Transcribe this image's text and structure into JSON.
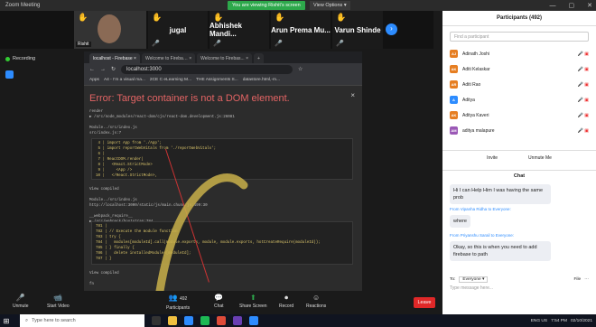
{
  "window": {
    "title": "Zoom Meeting",
    "banner": "You are viewing Rishit's screen",
    "view_options": "View Options ▾"
  },
  "controls": {
    "minimize": "—",
    "maximize": "▢",
    "close": "✕"
  },
  "participants_strip": [
    {
      "name": "jugal"
    },
    {
      "name": "Abhishek  Mandi..."
    },
    {
      "name": "Arun Prema Mu..."
    },
    {
      "name": "Varun Shinde"
    }
  ],
  "self": {
    "name": "Rishit"
  },
  "recording": "Recording",
  "browser": {
    "tabs": [
      "localhost - Firebase ×",
      "Welcome to Fireba… ×",
      "Welcome to Firebas... ×"
    ],
    "url": "localhost:3000",
    "bookmarks": [
      "Apps",
      "A4 - I'm a visual ma...",
      "2CE C eLearning M...",
      "THE Assignments S...",
      "datastore.html,-m..."
    ]
  },
  "error": {
    "title": "Error: Target container is not a DOM element.",
    "close": "×",
    "block1": "render\n▶ /src/node_modules/react-dom/cjs/react-dom.development.js:26081\n\nModule../src/index.js\nsrc/index.js:7",
    "code1": " 4 | import App from './App';\n 5 | import reportWebVitals from './reportWebVitals';\n 6 |\n 7 | ReactDOM.render(\n 8 |   <React.StrictMode>\n 9 |     <App />\n10 |   </React.StrictMode>,",
    "block2": "View compiled\n\nModule../src/index.js\nhttp://localhost:3000/static/js/main.chunk.js:499:30\n\n__webpack_require__\n▶ /src/webpack/bootstrap:784",
    "code2": "781 |\n782 | // Execute the module function\n783 | try {\n784 |   modules[moduleId].call(module.exports, module, module.exports, hotCreateRequire(moduleId));\n785 | } finally {\n786 |   delete installedModules[moduleId];\n787 | }",
    "footer": "View compiled\n\nfn"
  },
  "toolbar": {
    "unmute": "Unmute",
    "start_video": "Start Video",
    "participants": "Participants",
    "participants_count": "492",
    "chat": "Chat",
    "share_screen": "Share Screen",
    "record": "Record",
    "reactions": "Reactions",
    "leave": "Leave"
  },
  "panel": {
    "title": "Participants (492)",
    "search_placeholder": "Find a participant",
    "people": [
      {
        "name": "Adinath Joshi",
        "initials": "AJ",
        "color": "#e67e22"
      },
      {
        "name": "Aditi Kelaskar",
        "initials": "AK",
        "color": "#e67e22"
      },
      {
        "name": "Aditi Rao",
        "initials": "AR",
        "color": "#e67e22"
      },
      {
        "name": "Aditya",
        "initials": "A",
        "color": "#2d8cff"
      },
      {
        "name": "Aditya Kaveri",
        "initials": "AK",
        "color": "#e67e22"
      },
      {
        "name": "aditya malapure",
        "initials": "AM",
        "color": "#9b59b6"
      }
    ],
    "invite": "Invite",
    "unmute_me": "Unmute Me"
  },
  "chat": {
    "title": "Chat",
    "messages": [
      {
        "from": "",
        "text": "Hi I can Help Him I was having the same prob"
      },
      {
        "from": "From Vipanha Ridha to Everyone:",
        "text": "where"
      },
      {
        "from": "From Priyanshu Sarail to Everyone:",
        "text": "Okay, so this is when you need to add firebase to path"
      }
    ],
    "to_label": "To:",
    "to_value": "Everyone ▾",
    "file": "File",
    "more": "···",
    "input_placeholder": "Type message here..."
  },
  "taskbar": {
    "search": "Type here to search",
    "time": "7:54 PM",
    "date": "02/10/2021",
    "lang": "ENG US"
  }
}
